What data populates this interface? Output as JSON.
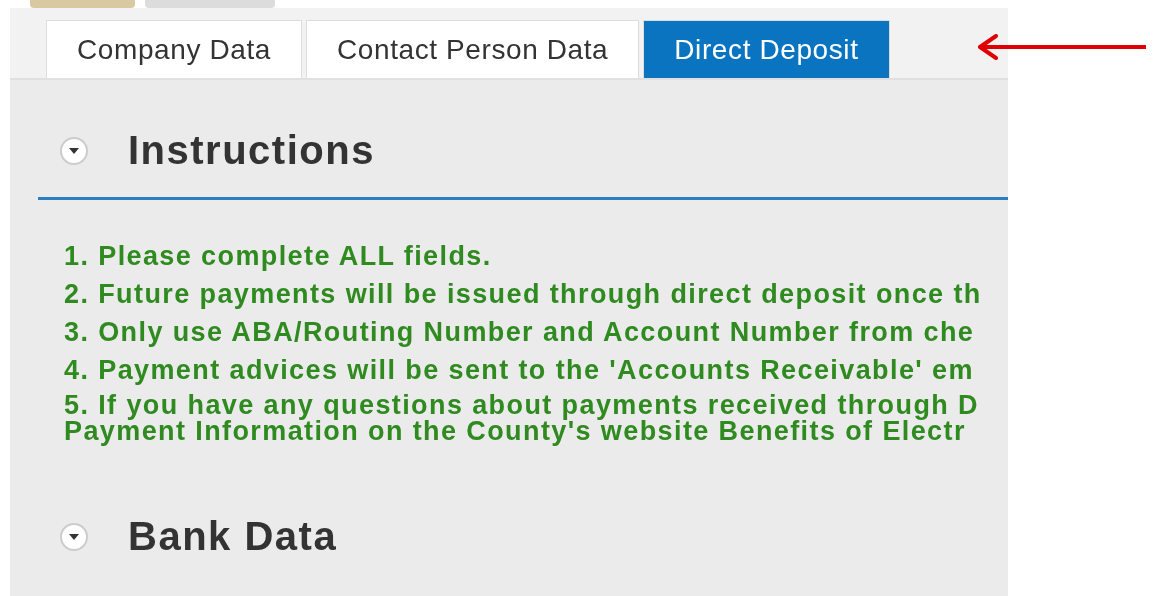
{
  "top_buttons": [
    {
      "kind": "emphasized"
    },
    {
      "kind": "default"
    }
  ],
  "tabs": [
    {
      "label": "Company Data",
      "selected": false
    },
    {
      "label": "Contact Person Data",
      "selected": false
    },
    {
      "label": "Direct Deposit",
      "selected": true
    }
  ],
  "sections": [
    {
      "title": "Instructions",
      "expanded": true,
      "items": [
        {
          "lines": [
            "1. Please complete ALL fields."
          ]
        },
        {
          "lines": [
            "2. Future payments will be issued through direct deposit once th"
          ]
        },
        {
          "lines": [
            "3. Only use ABA/Routing Number and Account Number from che"
          ]
        },
        {
          "lines": [
            "4. Payment advices will be sent to the 'Accounts Receivable' em"
          ]
        },
        {
          "lines": [
            "5. If you have any questions about payments received through D",
            "Payment Information on the County's website  Benefits of Electr"
          ]
        }
      ]
    },
    {
      "title": "Bank Data",
      "expanded": true
    }
  ],
  "annotation": {
    "kind": "arrow",
    "color": "#e00000"
  }
}
